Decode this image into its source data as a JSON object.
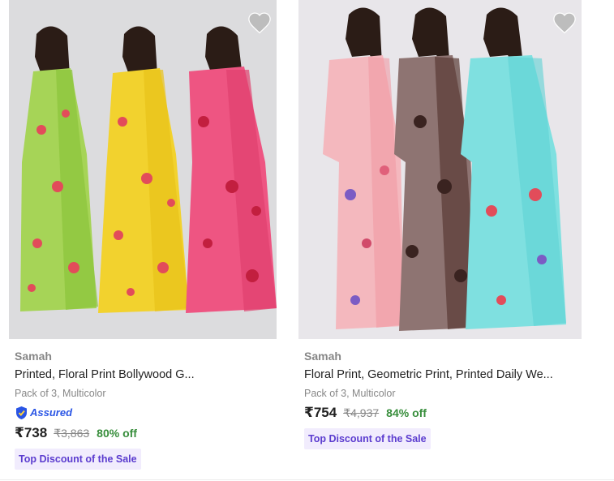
{
  "products": [
    {
      "brand": "Samah",
      "title": "Printed, Floral Print Bollywood G...",
      "pack": "Pack of 3, Multicolor",
      "assured_label": "Assured",
      "price": "₹738",
      "mrp": "₹3,863",
      "discount": "80% off",
      "badge": "Top Discount of the Sale",
      "saree_colors": [
        "#a6d457",
        "#f2d22e",
        "#ee5582"
      ]
    },
    {
      "brand": "Samah",
      "title": "Floral Print, Geometric Print, Printed Daily We...",
      "pack": "Pack of 3, Multicolor",
      "price": "₹754",
      "mrp": "₹4,937",
      "discount": "84% off",
      "badge": "Top Discount of the Sale",
      "saree_colors": [
        "#f4b8be",
        "#8e7472",
        "#7fe0e0"
      ]
    }
  ],
  "colors": {
    "wishlist": "#bdbdbd",
    "discount_green": "#388e3c",
    "badge_text": "#5b3ccf",
    "badge_bg": "#f1ecfd",
    "assured_blue": "#2a55e5"
  }
}
